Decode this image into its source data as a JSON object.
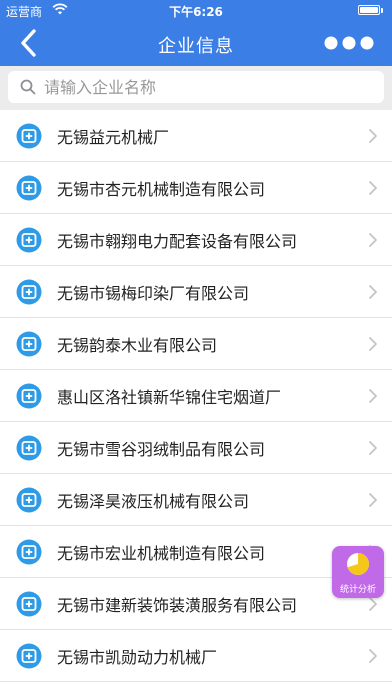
{
  "status_bar": {
    "carrier": "运营商",
    "time": "下午6:26"
  },
  "nav": {
    "title": "企业信息",
    "back_icon": "chevron-left-icon",
    "more_icon": "more-dots-icon"
  },
  "search": {
    "placeholder": "请输入企业名称",
    "value": ""
  },
  "companies": [
    "无锡益元机械厂",
    "无锡市杏元机械制造有限公司",
    "无锡市翱翔电力配套设备有限公司",
    "无锡市锡梅印染厂有限公司",
    "无锡韵泰木业有限公司",
    "惠山区洛社镇新华锦住宅烟道厂",
    "无锡市雪谷羽绒制品有限公司",
    "无锡泽昊液压机械有限公司",
    "无锡市宏业机械制造有限公司",
    "无锡市建新装饰装潢服务有限公司",
    "无锡市凯勋动力机械厂"
  ],
  "stats_button": {
    "label": "统计分析"
  },
  "colors": {
    "primary": "#3b7fe6",
    "list_icon": "#2f9be6",
    "stats_bg": "#c06ae8",
    "stats_pie": "#f5c71a"
  }
}
